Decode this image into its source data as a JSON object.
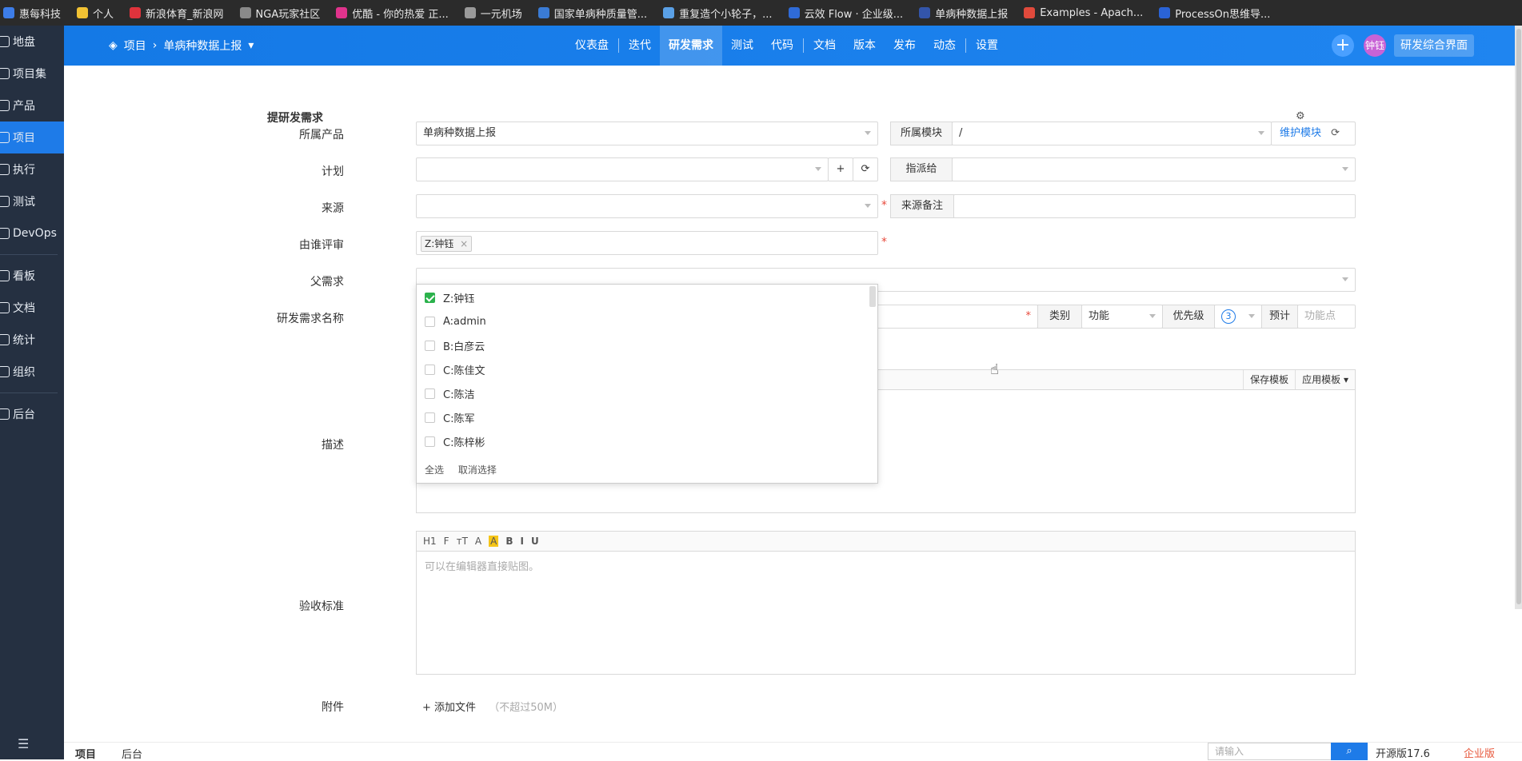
{
  "bookmarks": [
    {
      "label": "惠每科技",
      "color": "#3d7de8"
    },
    {
      "label": "个人",
      "color": "#f2c233"
    },
    {
      "label": "新浪体育_新浪网",
      "color": "#e0333c"
    },
    {
      "label": "NGA玩家社区",
      "color": "#8a8a8a"
    },
    {
      "label": "优酷 - 你的热爱 正...",
      "color": "#e0338c"
    },
    {
      "label": "一元机场",
      "color": "#9a9a9a"
    },
    {
      "label": "国家单病种质量管...",
      "color": "#3a7bd5"
    },
    {
      "label": "重复造个小轮子，...",
      "color": "#5aa0e6"
    },
    {
      "label": "云效 Flow · 企业级...",
      "color": "#2f6bd8"
    },
    {
      "label": "单病种数据上报",
      "color": "#3355aa"
    },
    {
      "label": "Examples - Apach...",
      "color": "#e04a3c"
    },
    {
      "label": "ProcessOn思维导...",
      "color": "#2a63d6"
    }
  ],
  "sidebar": {
    "items": [
      {
        "label": "地盘",
        "icon": "home-icon"
      },
      {
        "label": "项目集",
        "icon": "grid-icon"
      },
      {
        "label": "产品",
        "icon": "lightbulb-icon"
      },
      {
        "label": "项目",
        "icon": "rocket-icon",
        "active": true
      },
      {
        "label": "执行",
        "icon": "run-icon"
      },
      {
        "label": "测试",
        "icon": "search-icon"
      },
      {
        "label": "DevOps",
        "icon": "infinity-icon"
      },
      {
        "label": "看板",
        "icon": "board-icon"
      },
      {
        "label": "文档",
        "icon": "doc-icon"
      },
      {
        "label": "统计",
        "icon": "chart-icon"
      },
      {
        "label": "组织",
        "icon": "people-icon"
      },
      {
        "label": "后台",
        "icon": "gear-icon"
      }
    ]
  },
  "topbar": {
    "crumb_root": "项目",
    "crumb_current": "单病种数据上报",
    "nav": [
      "仪表盘",
      "迭代",
      "研发需求",
      "测试",
      "代码",
      "文档",
      "版本",
      "发布",
      "动态",
      "设置"
    ],
    "active_nav": "研发需求",
    "avatar_text": "钟钰",
    "workspace_button": "研发综合界面"
  },
  "form": {
    "title": "提研发需求",
    "product_label": "所属产品",
    "product_value": "单病种数据上报",
    "module_label": "所属模块",
    "module_value": "/",
    "maintain_module": "维护模块",
    "plan_label": "计划",
    "assign_label": "指派给",
    "source_label": "来源",
    "source_note_label": "来源备注",
    "reviewer_label": "由谁评审",
    "reviewer_tag": "Z:钟钰",
    "parent_label": "父需求",
    "name_label": "研发需求名称",
    "category_label": "类别",
    "category_value": "功能",
    "priority_label": "优先级",
    "priority_value": "3",
    "estimate_label": "预计",
    "estimate_placeholder": "功能点",
    "desc_label": "描述",
    "save_template": "保存模板",
    "apply_template": "应用模板",
    "acceptance_label": "验收标准",
    "editor_placeholder": "可以在编辑器直接贴图。",
    "attach_label": "附件",
    "add_file": "添加文件",
    "file_limit": "（不超过50M）"
  },
  "reviewer_dropdown": {
    "options": [
      {
        "label": "Z:钟钰",
        "checked": true
      },
      {
        "label": "A:admin",
        "checked": false
      },
      {
        "label": "B:白彦云",
        "checked": false
      },
      {
        "label": "C:陈佳文",
        "checked": false
      },
      {
        "label": "C:陈洁",
        "checked": false
      },
      {
        "label": "C:陈军",
        "checked": false
      },
      {
        "label": "C:陈梓彬",
        "checked": false
      }
    ],
    "select_all": "全选",
    "deselect": "取消选择"
  },
  "editor_toolbar": [
    "H1",
    "F",
    "тT",
    "A",
    "A",
    "B",
    "I",
    "U"
  ],
  "bottombar": {
    "tab_project": "项目",
    "tab_admin": "后台",
    "search_placeholder": "请输入",
    "version": "开源版17.6",
    "enterprise": "企业版"
  }
}
